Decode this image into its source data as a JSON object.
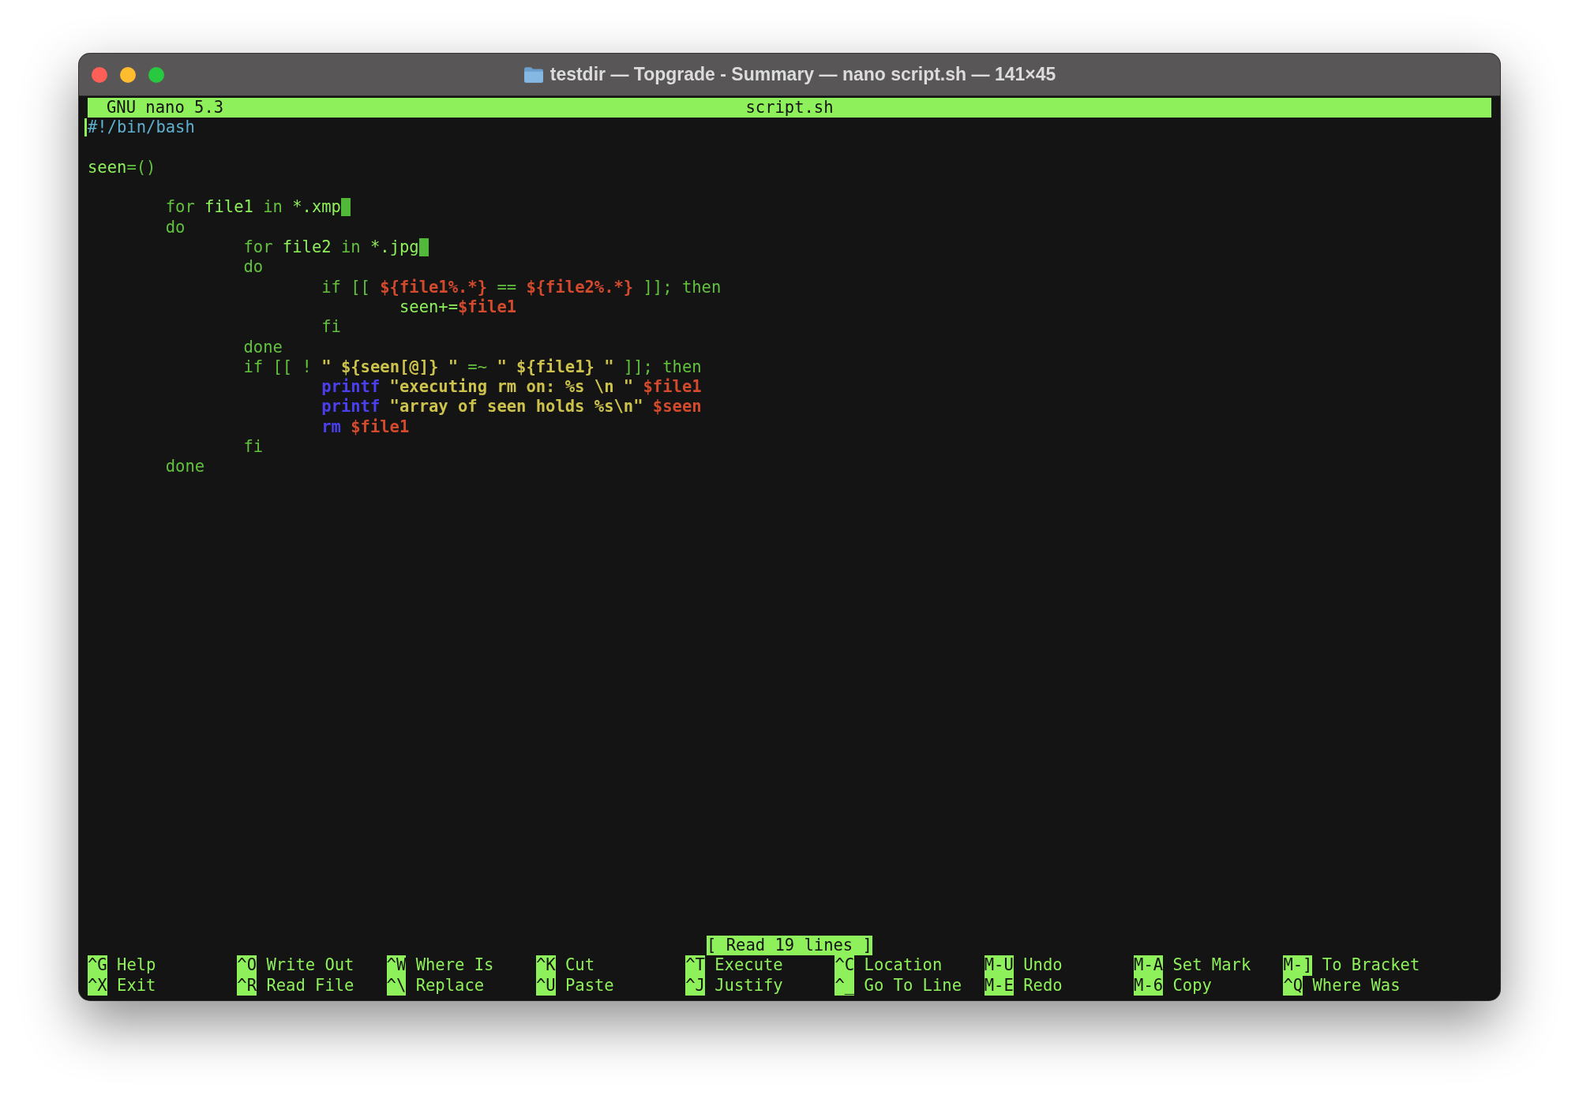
{
  "window": {
    "title": "testdir — Topgrade - Summary — nano script.sh — 141×45"
  },
  "header": {
    "app": "GNU nano 5.3",
    "filename": "script.sh"
  },
  "lines": [
    {
      "kind": "code",
      "tokens": [
        {
          "kind": "cursor"
        },
        {
          "text": "#!/bin/bash",
          "kind": "comment"
        }
      ]
    },
    {
      "kind": "blank"
    },
    {
      "kind": "code",
      "tokens": [
        {
          "text": "seen",
          "kind": "plain"
        },
        {
          "text": "=()",
          "kind": "keyword"
        }
      ]
    },
    {
      "kind": "blank"
    },
    {
      "kind": "code",
      "tokens": [
        {
          "text": "\tfor",
          "kind": "keyword"
        },
        {
          "text": " file1 ",
          "kind": "plain"
        },
        {
          "text": "in",
          "kind": "keyword"
        },
        {
          "text": " *.xmp",
          "kind": "plain"
        },
        {
          "kind": "trailing"
        }
      ]
    },
    {
      "kind": "code",
      "tokens": [
        {
          "text": "\tdo",
          "kind": "keyword"
        }
      ]
    },
    {
      "kind": "code",
      "tokens": [
        {
          "text": "\t\tfor",
          "kind": "keyword"
        },
        {
          "text": " file2 ",
          "kind": "plain"
        },
        {
          "text": "in",
          "kind": "keyword"
        },
        {
          "text": " *.jpg",
          "kind": "plain"
        },
        {
          "kind": "trailing"
        }
      ]
    },
    {
      "kind": "code",
      "tokens": [
        {
          "text": "\t\tdo",
          "kind": "keyword"
        }
      ]
    },
    {
      "kind": "code",
      "tokens": [
        {
          "text": "\t\t\tif [[ ",
          "kind": "keyword"
        },
        {
          "text": "${file1%.*}",
          "kind": "variable"
        },
        {
          "text": " == ",
          "kind": "keyword"
        },
        {
          "text": "${file2%.*}",
          "kind": "variable"
        },
        {
          "text": " ]]; then",
          "kind": "keyword"
        }
      ]
    },
    {
      "kind": "code",
      "tokens": [
        {
          "text": "\t\t\t\tseen+=",
          "kind": "plain"
        },
        {
          "text": "$file1",
          "kind": "variable"
        }
      ]
    },
    {
      "kind": "code",
      "tokens": [
        {
          "text": "\t\t\tfi",
          "kind": "keyword"
        }
      ]
    },
    {
      "kind": "code",
      "tokens": [
        {
          "text": "\t\tdone",
          "kind": "keyword"
        }
      ]
    },
    {
      "kind": "code",
      "tokens": [
        {
          "text": "\t\tif [[ ! ",
          "kind": "keyword"
        },
        {
          "text": "\" ${seen[@]} \"",
          "kind": "string"
        },
        {
          "text": " =~ ",
          "kind": "keyword"
        },
        {
          "text": "\" ${file1} \"",
          "kind": "string"
        },
        {
          "text": " ]]; then",
          "kind": "keyword"
        }
      ]
    },
    {
      "kind": "code",
      "tokens": [
        {
          "text": "\t\t\tprintf",
          "kind": "command"
        },
        {
          "text": " \"executing rm on: %s \\n \"",
          "kind": "string"
        },
        {
          "text": " $file1",
          "kind": "variable"
        }
      ]
    },
    {
      "kind": "code",
      "tokens": [
        {
          "text": "\t\t\tprintf",
          "kind": "command"
        },
        {
          "text": " \"array of seen holds %s\\n\"",
          "kind": "string"
        },
        {
          "text": " $seen",
          "kind": "variable"
        }
      ]
    },
    {
      "kind": "code",
      "tokens": [
        {
          "text": "\t\t\trm",
          "kind": "command"
        },
        {
          "text": " $file1",
          "kind": "variable"
        }
      ]
    },
    {
      "kind": "code",
      "tokens": [
        {
          "text": "\t\tfi",
          "kind": "keyword"
        }
      ]
    },
    {
      "kind": "code",
      "tokens": [
        {
          "text": "\tdone",
          "kind": "keyword"
        }
      ]
    }
  ],
  "status": "[ Read 19 lines ]",
  "shortcuts": [
    [
      {
        "key": "^G",
        "label": "Help"
      },
      {
        "key": "^X",
        "label": "Exit"
      }
    ],
    [
      {
        "key": "^O",
        "label": "Write Out"
      },
      {
        "key": "^R",
        "label": "Read File"
      }
    ],
    [
      {
        "key": "^W",
        "label": "Where Is"
      },
      {
        "key": "^\\",
        "label": "Replace"
      }
    ],
    [
      {
        "key": "^K",
        "label": "Cut"
      },
      {
        "key": "^U",
        "label": "Paste"
      }
    ],
    [
      {
        "key": "^T",
        "label": "Execute"
      },
      {
        "key": "^J",
        "label": "Justify"
      }
    ],
    [
      {
        "key": "^C",
        "label": "Location"
      },
      {
        "key": "^_",
        "label": "Go To Line"
      }
    ],
    [
      {
        "key": "M-U",
        "label": "Undo"
      },
      {
        "key": "M-E",
        "label": "Redo"
      }
    ],
    [
      {
        "key": "M-A",
        "label": "Set Mark"
      },
      {
        "key": "M-6",
        "label": "Copy"
      }
    ],
    [
      {
        "key": "M-]",
        "label": "To Bracket"
      },
      {
        "key": "^Q",
        "label": "Where Was"
      }
    ]
  ]
}
